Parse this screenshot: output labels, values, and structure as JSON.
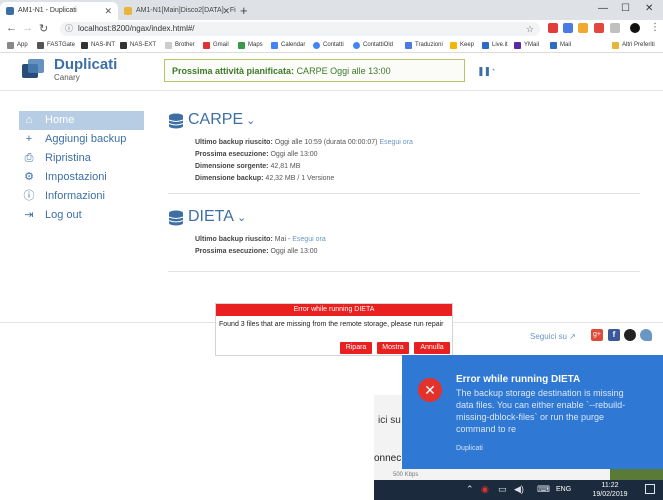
{
  "browser": {
    "tabs": [
      {
        "title": "AM1-N1 - Duplicati",
        "active": true
      },
      {
        "title": "AM1-N1[Main]Disco2[DATA] - Fi",
        "active": false
      }
    ],
    "url": "localhost:8200/ngax/index.html#/",
    "bookmarks": [
      "App",
      "FASTGate",
      "NAS-INT",
      "NAS-EXT",
      "Brother",
      "Gmail",
      "Maps",
      "Calendar",
      "Contatti",
      "ContattiOld",
      "Traduzioni",
      "Keep",
      "Live.it",
      "YMail",
      "Mail",
      "Altri Preferiti"
    ]
  },
  "app": {
    "title": "Duplicati",
    "subtitle": "Canary",
    "schedule_label": "Prossima attività pianificata:",
    "schedule_value": "CARPE Oggi alle 13:00"
  },
  "sidebar": {
    "items": [
      {
        "label": "Home",
        "icon": "home-icon"
      },
      {
        "label": "Aggiungi backup",
        "icon": "plus-icon"
      },
      {
        "label": "Ripristina",
        "icon": "restore-icon"
      },
      {
        "label": "Impostazioni",
        "icon": "gear-icon"
      },
      {
        "label": "Informazioni",
        "icon": "info-icon"
      },
      {
        "label": "Log out",
        "icon": "logout-icon"
      }
    ]
  },
  "backups": [
    {
      "name": "CARPE",
      "last_label": "Ultimo backup riuscito:",
      "last_value": "Oggi alle 10:59 (durata 00:00:07)",
      "run_now": "Esegui ora",
      "next_label": "Prossima esecuzione:",
      "next_value": "Oggi alle 13:00",
      "src_label": "Dimensione sorgente:",
      "src_value": "42,81 MB",
      "bk_label": "Dimensione backup:",
      "bk_value": "42,32 MB / 1 Versione"
    },
    {
      "name": "DIETA",
      "last_label": "Ultimo backup riuscito:",
      "last_value": "Mai - ",
      "run_now": "Esegui ora",
      "next_label": "Prossima esecuzione:",
      "next_value": "Oggi alle 13:00"
    }
  ],
  "footer": {
    "follow": "Seguici su"
  },
  "error_dialog": {
    "title": "Error while running DIETA",
    "message": "Found 3 files that are missing from the remote storage, please run repair",
    "buttons": [
      "Ripara",
      "Mostra",
      "Annulla"
    ]
  },
  "background_window": {
    "text1": "ici su",
    "text2": "onnec",
    "text3": "500 Kbps"
  },
  "toast": {
    "title": "Error while running DIETA",
    "message": "The backup storage destination is missing data files. You can either enable `--rebuild-missing-dblock-files` or run the purge command to re",
    "app": "Duplicati"
  },
  "taskbar": {
    "language": "ENG",
    "time": "11:22",
    "date": "19/02/2019"
  },
  "colors": {
    "accent": "#3d6fa5",
    "error": "#e8201f",
    "toast": "#2f78d3"
  }
}
